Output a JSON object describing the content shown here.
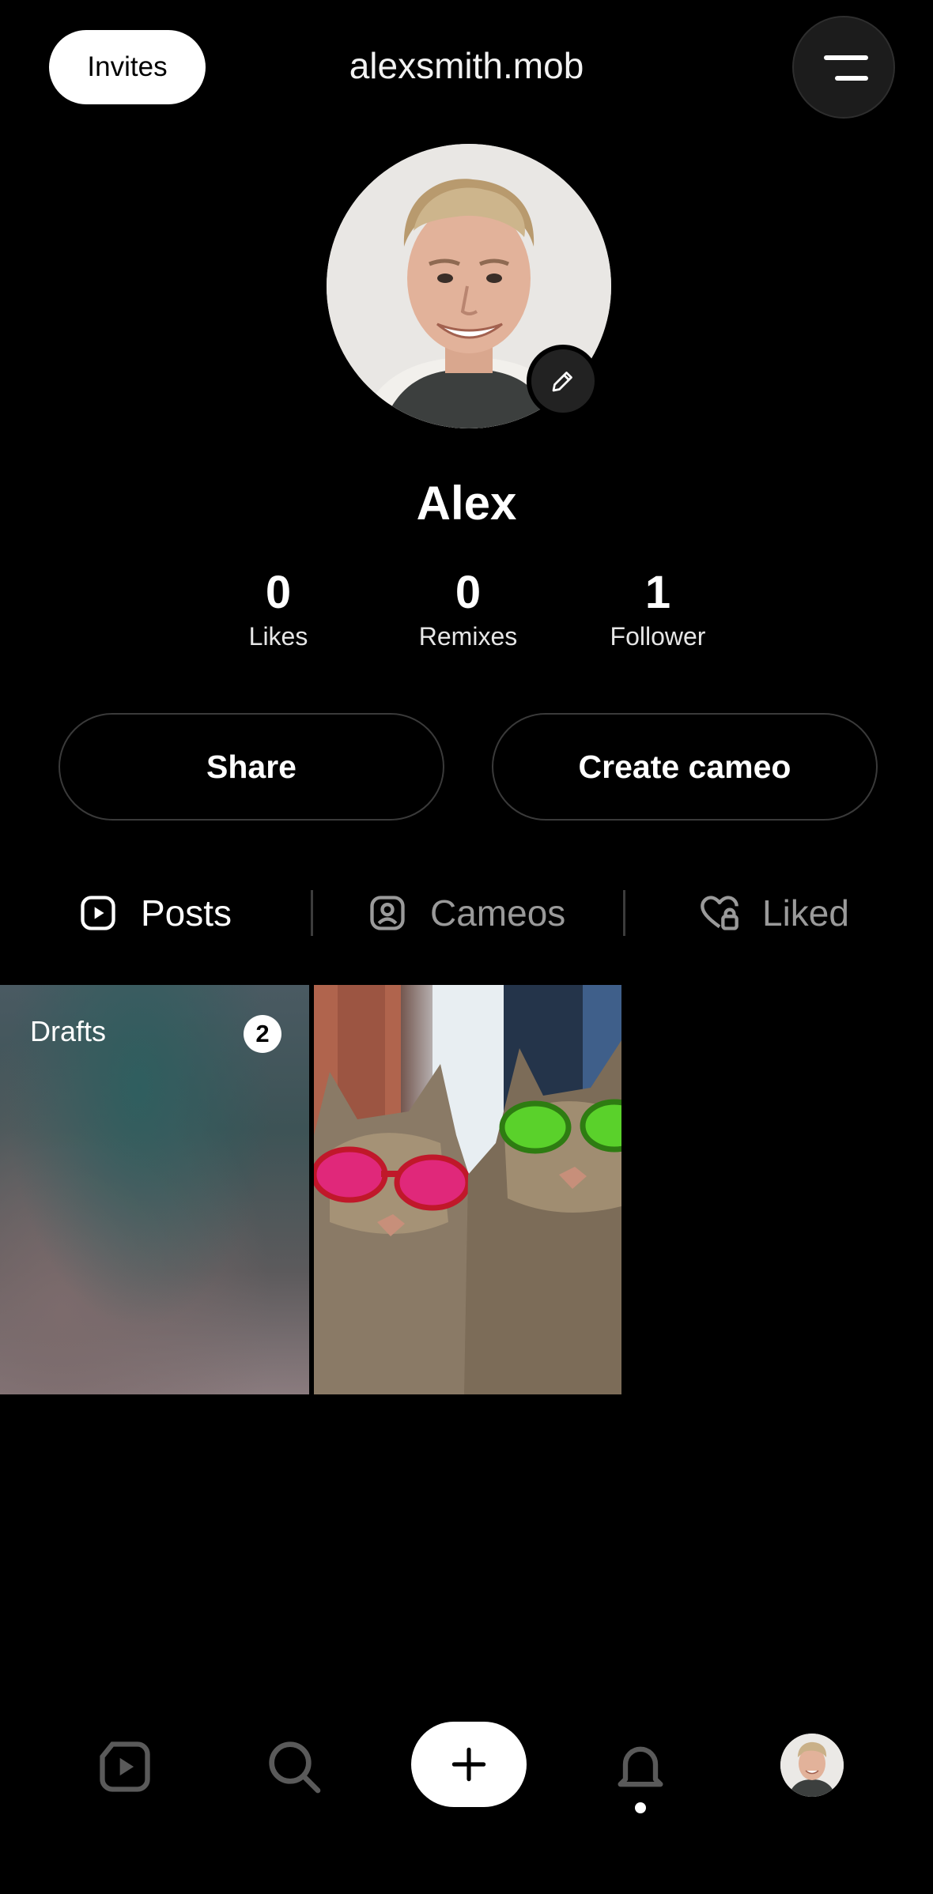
{
  "header": {
    "invites_label": "Invites",
    "username": "alexsmith.mob",
    "menu_icon": "hamburger-menu-icon"
  },
  "profile": {
    "display_name": "Alex",
    "avatar_icon": "profile-photo",
    "edit_icon": "pencil-icon"
  },
  "stats": [
    {
      "value": "0",
      "label": "Likes"
    },
    {
      "value": "0",
      "label": "Remixes"
    },
    {
      "value": "1",
      "label": "Follower"
    }
  ],
  "actions": {
    "share_label": "Share",
    "create_cameo_label": "Create cameo"
  },
  "tabs": [
    {
      "label": "Posts",
      "icon": "play-square-icon",
      "active": true
    },
    {
      "label": "Cameos",
      "icon": "person-square-icon",
      "active": false
    },
    {
      "label": "Liked",
      "icon": "heart-lock-icon",
      "active": false
    }
  ],
  "grid": {
    "drafts_label": "Drafts",
    "drafts_count": "2"
  },
  "bottom_nav": {
    "items": [
      "feed-icon",
      "search-icon",
      "plus-icon",
      "bell-icon",
      "profile-avatar"
    ],
    "notification_dot": true
  },
  "colors": {
    "background": "#000000",
    "active_tab": "#ffffff",
    "inactive_tab": "#9a9a9a"
  }
}
